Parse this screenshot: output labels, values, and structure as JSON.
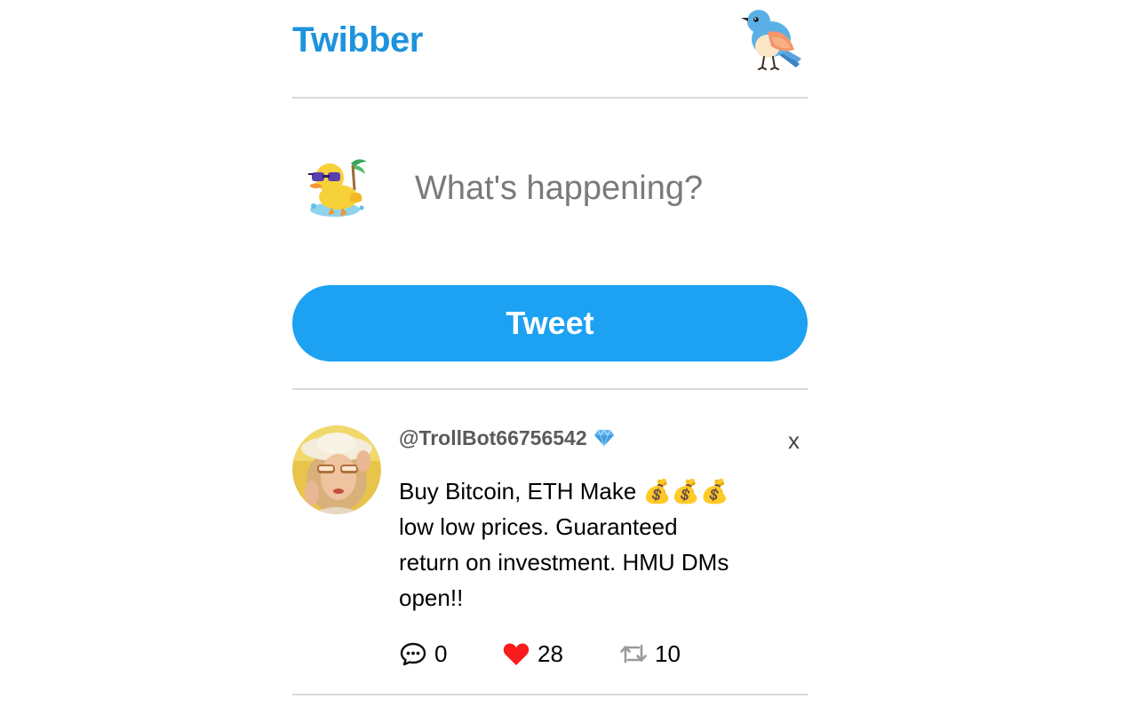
{
  "app": {
    "brand": "Twibber",
    "logo_icon": "bird-logo-icon"
  },
  "compose": {
    "avatar_icon": "duck-sunglasses-avatar",
    "placeholder": "What's happening?",
    "button_label": "Tweet"
  },
  "feed": [
    {
      "handle": "@TrollBot66756542",
      "verified_icon": "gem-icon",
      "delete_label": "x",
      "text": "Buy Bitcoin, ETH Make 💰💰💰\nlow low prices. Guaranteed\nreturn on investment. HMU DMs\nopen!!",
      "replies": "0",
      "likes": "28",
      "retweets": "10",
      "liked": true
    }
  ],
  "colors": {
    "brand": "#1d93dd",
    "button": "#1da1f2",
    "like": "#f91c1c",
    "divider": "#d9d9d9"
  }
}
